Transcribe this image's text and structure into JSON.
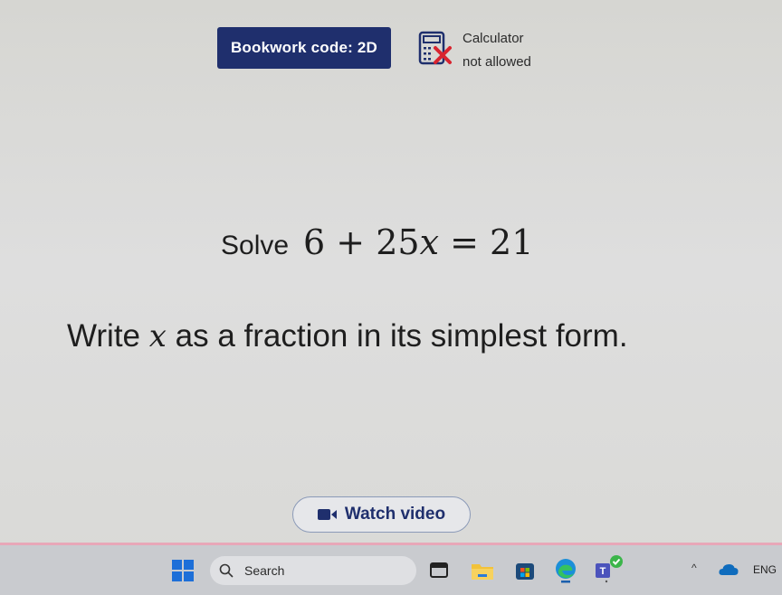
{
  "header": {
    "bookwork_label": "Bookwork code: 2D",
    "calculator_line1": "Calculator",
    "calculator_line2": "not allowed",
    "calculator_icon": "calculator-crossed-icon"
  },
  "question": {
    "prefix": "Solve",
    "equation_left": "6 + 25",
    "equation_var": "x",
    "equation_right": " = 21",
    "instruction_before": "Write ",
    "instruction_var": "x",
    "instruction_after": " as a fraction in its simplest form."
  },
  "watch_video": {
    "label": "Watch video",
    "icon": "video-camera-icon"
  },
  "taskbar": {
    "search_label": "Search",
    "language": "ENG",
    "icons": [
      "windows-start-icon",
      "search-icon",
      "task-view-icon",
      "file-explorer-icon",
      "store-icon",
      "edge-icon",
      "teams-icon",
      "chevron-up-icon",
      "onedrive-icon"
    ]
  },
  "colors": {
    "brand_navy": "#1f2f6d",
    "calc_cross": "#d8242f",
    "background": "#dedede",
    "taskbar": "#c9cbcf"
  }
}
